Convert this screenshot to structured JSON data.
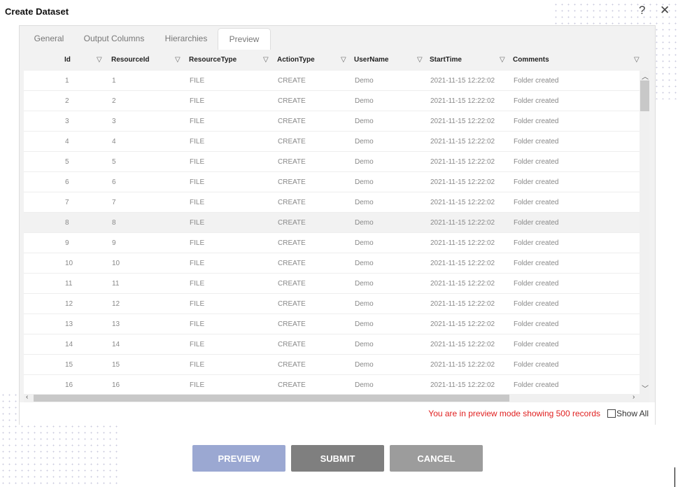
{
  "dialog": {
    "title": "Create Dataset",
    "help_icon": "question-icon",
    "close_icon": "close-icon"
  },
  "tabs": [
    {
      "label": "General"
    },
    {
      "label": "Output Columns"
    },
    {
      "label": "Hierarchies"
    },
    {
      "label": "Preview",
      "active": true
    }
  ],
  "columns": [
    "Id",
    "ResourceId",
    "ResourceType",
    "ActionType",
    "UserName",
    "StartTime",
    "Comments"
  ],
  "rows": [
    [
      "1",
      "1",
      "FILE",
      "CREATE",
      "Demo",
      "2021-11-15 12:22:02",
      "Folder created"
    ],
    [
      "2",
      "2",
      "FILE",
      "CREATE",
      "Demo",
      "2021-11-15 12:22:02",
      "Folder created"
    ],
    [
      "3",
      "3",
      "FILE",
      "CREATE",
      "Demo",
      "2021-11-15 12:22:02",
      "Folder created"
    ],
    [
      "4",
      "4",
      "FILE",
      "CREATE",
      "Demo",
      "2021-11-15 12:22:02",
      "Folder created"
    ],
    [
      "5",
      "5",
      "FILE",
      "CREATE",
      "Demo",
      "2021-11-15 12:22:02",
      "Folder created"
    ],
    [
      "6",
      "6",
      "FILE",
      "CREATE",
      "Demo",
      "2021-11-15 12:22:02",
      "Folder created"
    ],
    [
      "7",
      "7",
      "FILE",
      "CREATE",
      "Demo",
      "2021-11-15 12:22:02",
      "Folder created"
    ],
    [
      "8",
      "8",
      "FILE",
      "CREATE",
      "Demo",
      "2021-11-15 12:22:02",
      "Folder created"
    ],
    [
      "9",
      "9",
      "FILE",
      "CREATE",
      "Demo",
      "2021-11-15 12:22:02",
      "Folder created"
    ],
    [
      "10",
      "10",
      "FILE",
      "CREATE",
      "Demo",
      "2021-11-15 12:22:02",
      "Folder created"
    ],
    [
      "11",
      "11",
      "FILE",
      "CREATE",
      "Demo",
      "2021-11-15 12:22:02",
      "Folder created"
    ],
    [
      "12",
      "12",
      "FILE",
      "CREATE",
      "Demo",
      "2021-11-15 12:22:02",
      "Folder created"
    ],
    [
      "13",
      "13",
      "FILE",
      "CREATE",
      "Demo",
      "2021-11-15 12:22:02",
      "Folder created"
    ],
    [
      "14",
      "14",
      "FILE",
      "CREATE",
      "Demo",
      "2021-11-15 12:22:02",
      "Folder created"
    ],
    [
      "15",
      "15",
      "FILE",
      "CREATE",
      "Demo",
      "2021-11-15 12:22:02",
      "Folder created"
    ],
    [
      "16",
      "16",
      "FILE",
      "CREATE",
      "Demo",
      "2021-11-15 12:22:02",
      "Folder created"
    ]
  ],
  "highlighted_row": 8,
  "footer": {
    "message": "You are in preview mode showing 500 records",
    "show_all_label": "Show All",
    "show_all_checked": false
  },
  "buttons": {
    "preview": "PREVIEW",
    "submit": "SUBMIT",
    "cancel": "CANCEL"
  },
  "colors": {
    "preview": "#9ba8d2",
    "submit": "#7f7f7f",
    "cancel": "#9c9c9c",
    "message": "#e02020"
  }
}
